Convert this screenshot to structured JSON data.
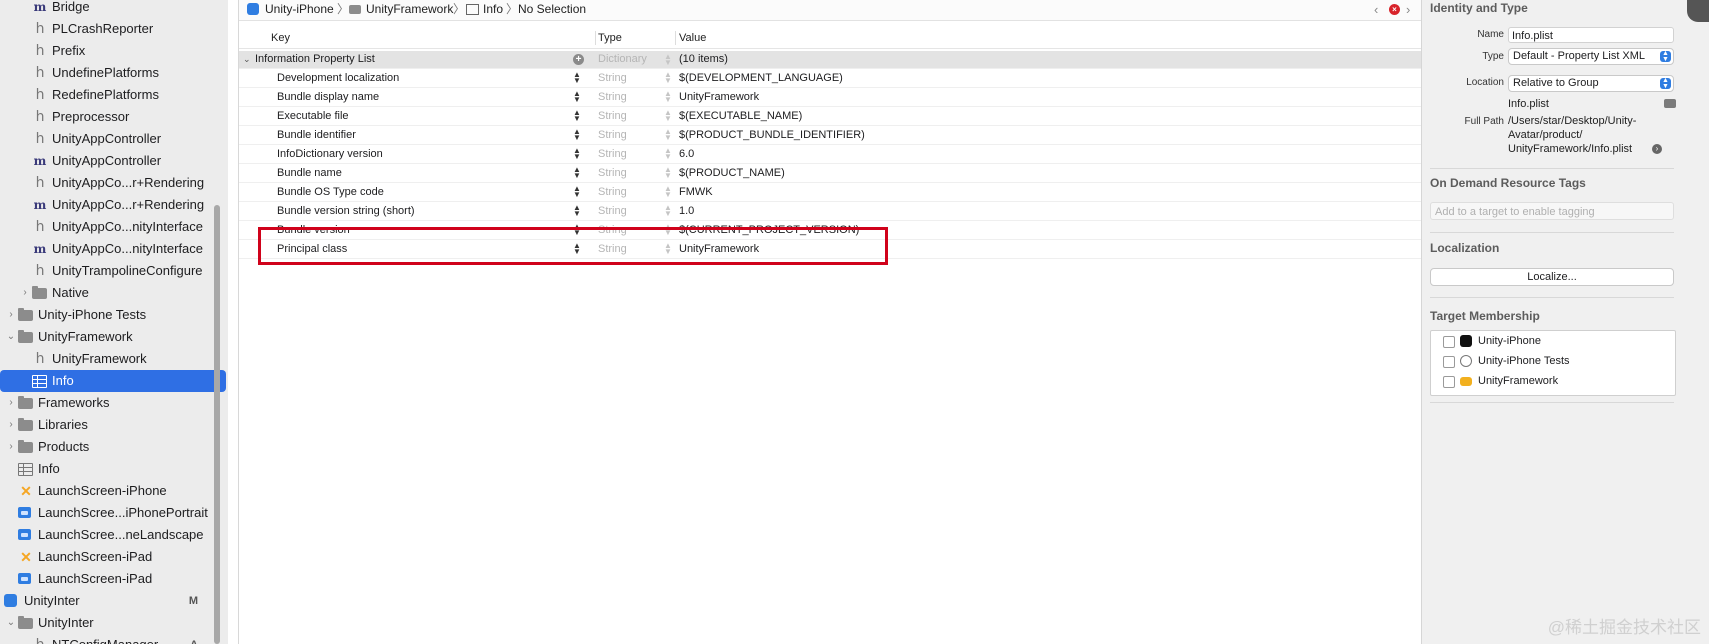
{
  "navigator": {
    "items": [
      {
        "label": "Bridge",
        "icon": "m-icon",
        "level": 3
      },
      {
        "label": "PLCrashReporter",
        "icon": "h-icon",
        "level": 3
      },
      {
        "label": "Prefix",
        "icon": "h-icon",
        "level": 3
      },
      {
        "label": "UndefinePlatforms",
        "icon": "h-icon",
        "level": 3
      },
      {
        "label": "RedefinePlatforms",
        "icon": "h-icon",
        "level": 3
      },
      {
        "label": "Preprocessor",
        "icon": "h-icon",
        "level": 3
      },
      {
        "label": "UnityAppController",
        "icon": "h-icon",
        "level": 3
      },
      {
        "label": "UnityAppController",
        "icon": "m-icon",
        "level": 3
      },
      {
        "label": "UnityAppCo...r+Rendering",
        "icon": "h-icon",
        "level": 3
      },
      {
        "label": "UnityAppCo...r+Rendering",
        "icon": "m-icon",
        "level": 3
      },
      {
        "label": "UnityAppCo...nityInterface",
        "icon": "h-icon",
        "level": 3
      },
      {
        "label": "UnityAppCo...nityInterface",
        "icon": "m-icon",
        "level": 3
      },
      {
        "label": "UnityTrampolineConfigure",
        "icon": "h-icon",
        "level": 3
      },
      {
        "label": "Native",
        "icon": "folder-icon",
        "level": 2,
        "disclosure": "›"
      },
      {
        "label": "Unity-iPhone Tests",
        "icon": "folder-icon",
        "level": 1,
        "disclosure": "›"
      },
      {
        "label": "UnityFramework",
        "icon": "folder-icon",
        "level": 1,
        "disclosure": "⌄"
      },
      {
        "label": "UnityFramework",
        "icon": "h-icon",
        "level": 3
      },
      {
        "label": "Info",
        "icon": "plist-icon",
        "level": 3,
        "selected": true
      },
      {
        "label": "Frameworks",
        "icon": "folder-icon",
        "level": 1,
        "disclosure": "›"
      },
      {
        "label": "Libraries",
        "icon": "folder-icon",
        "level": 1,
        "disclosure": "›"
      },
      {
        "label": "Products",
        "icon": "folder-icon",
        "level": 1,
        "disclosure": "›"
      },
      {
        "label": "Info",
        "icon": "plist-icon",
        "level": 1
      },
      {
        "label": "LaunchScreen-iPhone",
        "icon": "xib-icon",
        "level": 1
      },
      {
        "label": "LaunchScree...iPhonePortrait",
        "icon": "image-icon",
        "level": 1
      },
      {
        "label": "LaunchScree...neLandscape",
        "icon": "image-icon",
        "level": 1
      },
      {
        "label": "LaunchScreen-iPad",
        "icon": "xib-icon",
        "level": 1
      },
      {
        "label": "LaunchScreen-iPad",
        "icon": "image-icon",
        "level": 1
      },
      {
        "label": "UnityInter",
        "icon": "project-icon",
        "level": 0,
        "disclosure": "⌄",
        "badge": "M"
      },
      {
        "label": "UnityInter",
        "icon": "folder-icon",
        "level": 1,
        "disclosure": "⌄"
      },
      {
        "label": "NTConfigManager",
        "icon": "h-icon",
        "level": 3,
        "badge": "A"
      }
    ]
  },
  "jumpbar": {
    "crumbs": [
      "Unity-iPhone",
      "UnityFramework",
      "Info",
      "No Selection"
    ]
  },
  "plist": {
    "headers": {
      "key": "Key",
      "type": "Type",
      "value": "Value"
    },
    "root": {
      "key": "Information Property List",
      "type": "Dictionary",
      "value": "(10 items)"
    },
    "rows": [
      {
        "key": "Development localization",
        "type": "String",
        "value": "$(DEVELOPMENT_LANGUAGE)"
      },
      {
        "key": "Bundle display name",
        "type": "String",
        "value": "UnityFramework"
      },
      {
        "key": "Executable file",
        "type": "String",
        "value": "$(EXECUTABLE_NAME)"
      },
      {
        "key": "Bundle identifier",
        "type": "String",
        "value": "$(PRODUCT_BUNDLE_IDENTIFIER)"
      },
      {
        "key": "InfoDictionary version",
        "type": "String",
        "value": "6.0"
      },
      {
        "key": "Bundle name",
        "type": "String",
        "value": "$(PRODUCT_NAME)"
      },
      {
        "key": "Bundle OS Type code",
        "type": "String",
        "value": "FMWK"
      },
      {
        "key": "Bundle version string (short)",
        "type": "String",
        "value": "1.0"
      },
      {
        "key": "Bundle version",
        "type": "String",
        "value": "$(CURRENT_PROJECT_VERSION)"
      },
      {
        "key": "Principal class",
        "type": "String",
        "value": "UnityFramework"
      }
    ],
    "highlight_color": "#d0021b"
  },
  "inspector": {
    "identity_title": "Identity and Type",
    "name_label": "Name",
    "name_value": "Info.plist",
    "type_label": "Type",
    "type_value": "Default - Property List XML",
    "location_label": "Location",
    "location_value": "Relative to Group",
    "location_file": "Info.plist",
    "fullpath_label": "Full Path",
    "fullpath_lines": [
      "/Users/star/Desktop/Unity-",
      "Avatar/product/",
      "UnityFramework/Info.plist"
    ],
    "tags_title": "On Demand Resource Tags",
    "tags_placeholder": "Add to a target to enable tagging",
    "localization_title": "Localization",
    "localize_button": "Localize...",
    "membership_title": "Target Membership",
    "targets": [
      {
        "label": "Unity-iPhone",
        "icon": "unity-app-icon"
      },
      {
        "label": "Unity-iPhone Tests",
        "icon": "test-target-icon"
      },
      {
        "label": "UnityFramework",
        "icon": "framework-icon"
      }
    ]
  },
  "watermark": "@稀土掘金技术社区"
}
